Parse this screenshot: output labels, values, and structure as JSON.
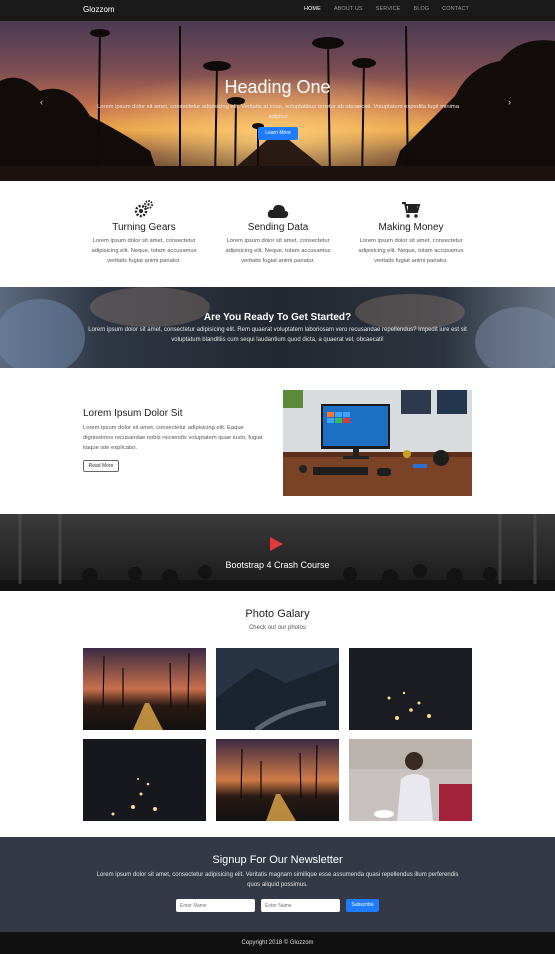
{
  "navbar": {
    "brand": "Glozzom",
    "links": [
      "HOME",
      "ABOUT US",
      "SERVICE",
      "BLOG",
      "CONTACT"
    ]
  },
  "hero": {
    "title": "Heading One",
    "text": "Lorem ipsum dolor sit amet, consectetur adipisicing elit. Veritatis at esse, voluptatibus tenetur ab obcaecati. Voluptatem expedita fugit minima adipisci",
    "button": "Learn More"
  },
  "features": [
    {
      "icon": "gears-icon",
      "title": "Turning Gears",
      "text": "Lorem ipsum dolor sit amet, consectetur adipisicing elit. Neque, totam accusamus veritatis fugiat animi pariatur."
    },
    {
      "icon": "cloud-icon",
      "title": "Sending Data",
      "text": "Lorem ipsum dolor sit amet, consectetur adipisicing elit. Neque, totam accusamus veritatis fugiat animi pariatur."
    },
    {
      "icon": "cart-icon",
      "title": "Making Money",
      "text": "Lorem ipsum dolor sit amet, consectetur adipisicing elit. Neque, totam accusamus veritatis fugiat animi pariatur."
    }
  ],
  "cta": {
    "title": "Are You Ready To Get Started?",
    "text": "Lorem ipsum dolor sit amet, consectetur adipisicing elit. Rem quaerat voluptatem laboriosam vero recusandae repellendus? Impedit iure est sit voluptatum blanditiis cum sequi laudantium quod dicta, a quaerat vel, obcaecati!"
  },
  "info": {
    "title": "Lorem Ipsum Dolor Sit",
    "text": "Lorem ipsum dolor sit amet, consectetur adipisicing elit. Eaque dignissimos recusandae nobis reiciendis voluptatem quae iusto, fugiat itaque iste explicabo.",
    "button": "Read More"
  },
  "video": {
    "title": "Bootstrap 4 Crash Course"
  },
  "gallery": {
    "title": "Photo Galary",
    "subtitle": "Check out our photos"
  },
  "newsletter": {
    "title": "Signup For Our Newsletter",
    "text": "Lorem ipsum dolor sit amet, consectetur adipisicing elit. Veritatis magnam similique esse assumenda quasi repellendus illum perferendis quos aliquid possimus.",
    "name_placeholder": "Enter Name",
    "email_placeholder": "Enter Name",
    "button": "Subscribe"
  },
  "footer": {
    "text": "Copyright 2018 © Glozzom"
  },
  "colors": {
    "accent": "#1f7bff",
    "play": "#e53935",
    "dark": "#343a45"
  }
}
